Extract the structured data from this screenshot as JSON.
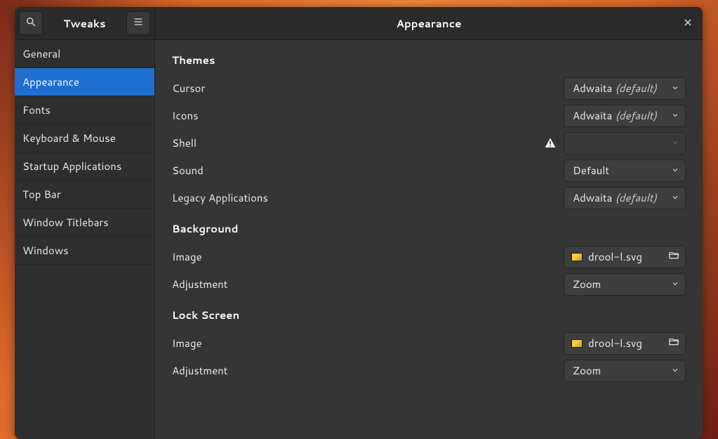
{
  "sidebar": {
    "title": "Tweaks",
    "items": [
      {
        "label": "General"
      },
      {
        "label": "Appearance"
      },
      {
        "label": "Fonts"
      },
      {
        "label": "Keyboard & Mouse"
      },
      {
        "label": "Startup Applications"
      },
      {
        "label": "Top Bar"
      },
      {
        "label": "Window Titlebars"
      },
      {
        "label": "Windows"
      }
    ],
    "selected_index": 1
  },
  "header": {
    "title": "Appearance"
  },
  "sections": {
    "themes": {
      "title": "Themes",
      "cursor": {
        "label": "Cursor",
        "value": "Adwaita",
        "suffix": "(default)"
      },
      "icons": {
        "label": "Icons",
        "value": "Adwaita",
        "suffix": "(default)"
      },
      "shell": {
        "label": "Shell",
        "value": ""
      },
      "sound": {
        "label": "Sound",
        "value": "Default"
      },
      "legacy": {
        "label": "Legacy Applications",
        "value": "Adwaita",
        "suffix": "(default)"
      }
    },
    "background": {
      "title": "Background",
      "image": {
        "label": "Image",
        "file": "drool-l.svg"
      },
      "adjustment": {
        "label": "Adjustment",
        "value": "Zoom"
      }
    },
    "lockscreen": {
      "title": "Lock Screen",
      "image": {
        "label": "Image",
        "file": "drool-l.svg"
      },
      "adjustment": {
        "label": "Adjustment",
        "value": "Zoom"
      }
    }
  }
}
